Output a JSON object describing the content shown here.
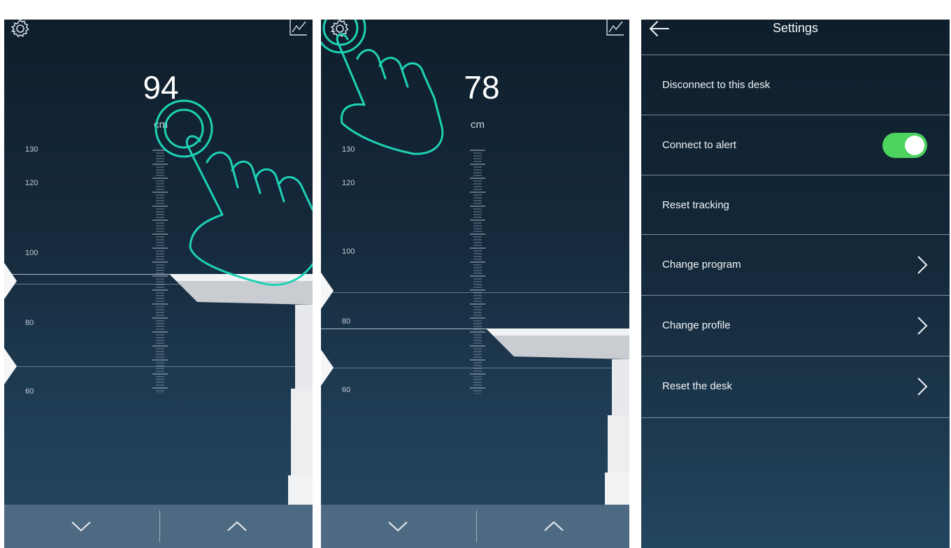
{
  "panel1": {
    "height_value": "94",
    "height_unit": "cm",
    "scale_labels": [
      "130",
      "120",
      "100",
      "80",
      "60"
    ]
  },
  "panel2": {
    "height_value": "78",
    "height_unit": "cm",
    "scale_labels": [
      "130",
      "120",
      "100",
      "80",
      "60"
    ]
  },
  "icons": {
    "settings": "gear-icon",
    "stats": "line-chart-icon",
    "down": "chevron-down-icon",
    "up": "chevron-up-icon",
    "back": "arrow-left-icon",
    "gesture": "tap-hand-icon"
  },
  "settings": {
    "title": "Settings",
    "items": [
      {
        "label": "Disconnect to this desk",
        "control": "none"
      },
      {
        "label": "Connect to alert",
        "control": "toggle",
        "on": true
      },
      {
        "label": "Reset tracking",
        "control": "none"
      },
      {
        "label": "Change program",
        "control": "chevron"
      },
      {
        "label": "Change profile",
        "control": "chevron"
      },
      {
        "label": "Reset the desk",
        "control": "chevron"
      }
    ]
  },
  "colors": {
    "background_top": "#0f1e2c",
    "background_bottom": "#244760",
    "bottom_bar": "#4e6a82",
    "toggle_on": "#4cd45e",
    "gesture": "#1ed2b4"
  }
}
